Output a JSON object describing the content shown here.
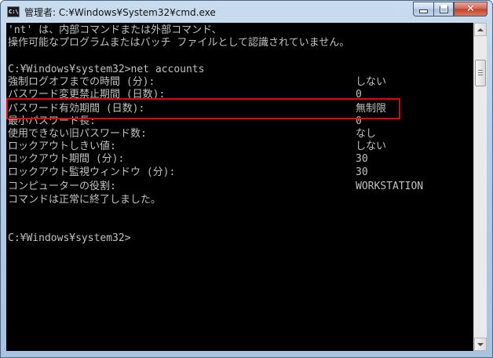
{
  "window": {
    "title": "管理者: C:¥Windows¥System32¥cmd.exe",
    "icon": "cmd-icon",
    "icon_text": "C:\\"
  },
  "console": {
    "lines": [
      "'nt' は、内部コマンドまたは外部コマンド、",
      "操作可能なプログラムまたはバッチ ファイルとして認識されていません。",
      "",
      "C:¥Windows¥system32>net accounts",
      "強制ログオフまでの時間 (分):",
      "パスワード変更禁止期間 (日数):",
      "パスワード有効期間 (日数):",
      "最小パスワード長:",
      "使用できない旧パスワード数:",
      "ロックアウトしきい値:",
      "ロックアウト期間 (分):",
      "ロックアウト監視ウィンドウ (分):",
      "コンピューターの役割:",
      "コマンドは正常に終了しました。",
      "",
      "",
      "C:¥Windows¥system32>"
    ],
    "values": {
      "force_logoff": "しない",
      "min_pw_age": "0",
      "max_pw_age": "無制限",
      "min_pw_len": "0",
      "pw_history": "なし",
      "lockout_threshold": "しない",
      "lockout_duration": "30",
      "lockout_window": "30",
      "computer_role": "WORKSTATION"
    }
  },
  "colors": {
    "console_bg": "#000000",
    "console_text": "#c0c0c0",
    "highlight": "#e8000e"
  }
}
